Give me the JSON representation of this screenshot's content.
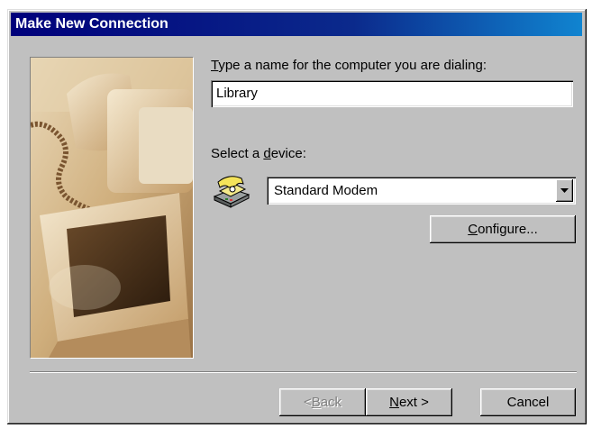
{
  "window": {
    "title": "Make New Connection"
  },
  "form": {
    "name_label_access": "T",
    "name_label_rest": "ype a name for the computer you are dialing:",
    "name_value": "Library",
    "device_label_pre": "Select a ",
    "device_label_access": "d",
    "device_label_post": "evice:",
    "device_value": "Standard Modem",
    "configure_access": "C",
    "configure_rest": "onfigure..."
  },
  "buttons": {
    "back_pre": "< ",
    "back_access": "B",
    "back_post": "ack",
    "next_access": "N",
    "next_post": "ext >",
    "cancel": "Cancel"
  },
  "icons": {
    "device_icon": "modem-telephone-icon",
    "dropdown_icon": "dropdown-arrow-icon",
    "illustration": "computer-monitors-illustration"
  }
}
